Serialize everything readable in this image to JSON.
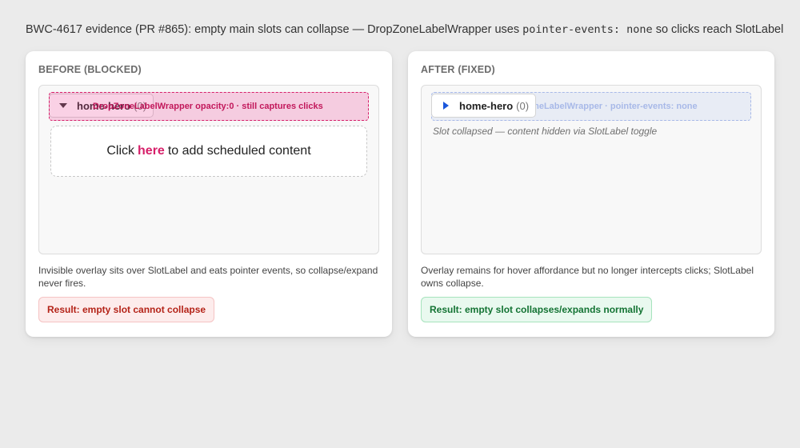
{
  "headline": {
    "prefix": "BWC-4617 evidence (PR #865): empty main slots can collapse — DropZoneLabelWrapper uses ",
    "code": "pointer-events: none",
    "suffix": " so clicks reach SlotLabel"
  },
  "before": {
    "title": "BEFORE (BLOCKED)",
    "slot_name": "home-hero",
    "slot_count": "(0)",
    "overlay_text": "DropZoneLabelWrapper opacity:0 · still captures clicks",
    "empty_prefix": "Click",
    "empty_link": "here",
    "empty_suffix": "to add scheduled content",
    "description": "Invisible overlay sits over SlotLabel and eats pointer events, so collapse/expand never fires.",
    "result": "Result: empty slot cannot collapse"
  },
  "after": {
    "title": "AFTER (FIXED)",
    "slot_name": "home-hero",
    "slot_count": "(0)",
    "overlay_text": "DropZoneLabelWrapper · pointer-events: none",
    "collapsed_note": "Slot collapsed — content hidden via SlotLabel toggle",
    "description": "Overlay remains for hover affordance but no longer intercepts clicks; SlotLabel owns collapse.",
    "result": "Result: empty slot collapses/expands normally"
  },
  "colors": {
    "accent_pink": "#d61f69",
    "caret_blue": "#1a56db",
    "bad": "#b42318",
    "good": "#137333"
  },
  "icons": {
    "before_caret": "caret-down-icon",
    "after_caret": "caret-right-icon"
  }
}
